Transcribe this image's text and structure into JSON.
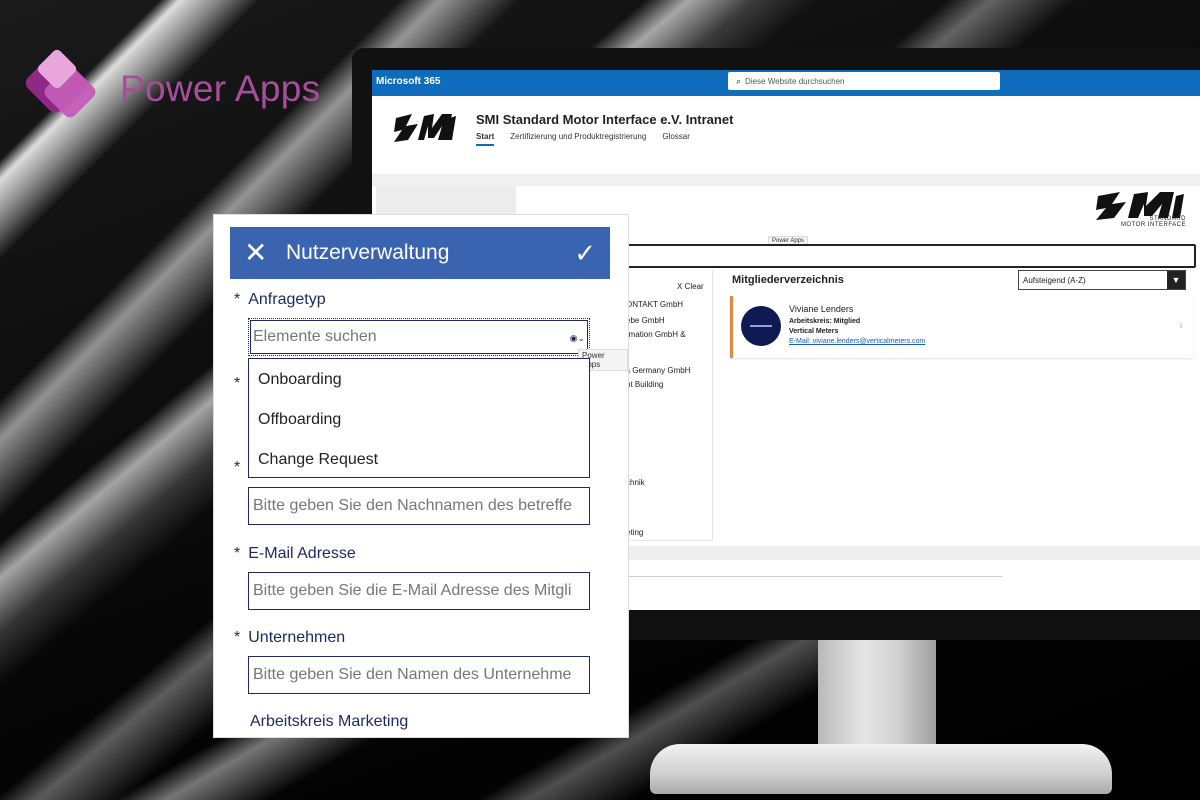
{
  "brand": {
    "name": "Power Apps",
    "colors": {
      "primary": "#a84d9a",
      "dark": "#8e2a86",
      "light": "#e8a6dc"
    }
  },
  "sharepoint": {
    "suite": "Microsoft 365",
    "search_placeholder": "Diese Website durchsuchen",
    "site_title": "SMI Standard Motor Interface e.V. Intranet",
    "nav": [
      "Start",
      "Zertifizierung und Produktregistrierung",
      "Glossar"
    ],
    "logo_text": "SMI",
    "logo_subtitle_1": "STANDARD",
    "logo_subtitle_2": "MOTOR INTERFACE",
    "section_heading_fragment": "n",
    "power_apps_tag": "Power Apps",
    "clear_label": "X Clear",
    "list_fragments": [
      "ONTAKT GmbH",
      "ebe GmbH",
      "rmation GmbH &",
      "s Germany GmbH",
      "nt Building",
      "chnik",
      "eting"
    ],
    "directory": {
      "title": "Mitgliederverzeichnis",
      "sort_label": "Aufsteigend (A-Z)",
      "card": {
        "name": "Viviane Lenders",
        "line1": "Arbeitskreis: Mitglied",
        "line2": "Vertical Meters",
        "email": "E-Mail: viviane.lenders@verticalmeters.com"
      }
    },
    "colors": {
      "topbar": "#0f6cbd",
      "card_accent": "#e08a3c",
      "link": "#1a5bc0"
    }
  },
  "form": {
    "title": "Nutzerverwaltung",
    "fields": {
      "request_type_label": "Anfragetyp",
      "search_placeholder": "Elemente suchen",
      "search_tooltip": "Power Apps",
      "options": [
        "Onboarding",
        "Offboarding",
        "Change Request"
      ],
      "lastname_placeholder": "Bitte geben Sie den Nachnamen des betreffe",
      "email_label": "E-Mail Adresse",
      "email_placeholder": "Bitte geben Sie die E-Mail Adresse des Mitgli",
      "company_label": "Unternehmen",
      "company_placeholder": "Bitte geben Sie den Namen des Unternehme",
      "marketing_label": "Arbeitskreis Marketing"
    },
    "required_mark": "*",
    "colors": {
      "header": "#3a63b0",
      "text": "#1e2a62"
    }
  }
}
